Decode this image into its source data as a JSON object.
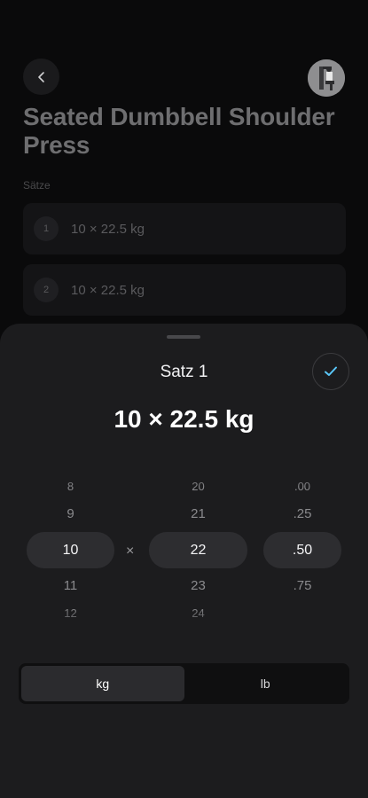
{
  "exercise": {
    "title": "Seated Dumbbell Shoulder Press",
    "sets_label": "Sätze",
    "sets": [
      {
        "number": "1",
        "text": "10 × 22.5 kg"
      },
      {
        "number": "2",
        "text": "10 × 22.5 kg"
      }
    ]
  },
  "sheet": {
    "title": "Satz 1",
    "value": "10 × 22.5 kg",
    "times_sign": "×",
    "reps_picker": {
      "above": [
        "8",
        "9"
      ],
      "selected": "10",
      "below": [
        "11",
        "12"
      ]
    },
    "weight_picker": {
      "above": [
        "20",
        "21"
      ],
      "selected": "22",
      "below": [
        "23",
        "24"
      ]
    },
    "fraction_picker": {
      "above": [
        ".00",
        ".25"
      ],
      "selected": ".50",
      "below": [
        ".75"
      ]
    },
    "units": {
      "options": [
        "kg",
        "lb"
      ],
      "selected": "kg"
    }
  },
  "colors": {
    "accent": "#5ac8fa",
    "sheet_bg": "#1c1c1e",
    "selected_bg": "#2d2d30"
  },
  "icons": {
    "back": "chevron-left-icon",
    "confirm": "checkmark-icon",
    "thumbnail": "exercise-thumbnail"
  }
}
